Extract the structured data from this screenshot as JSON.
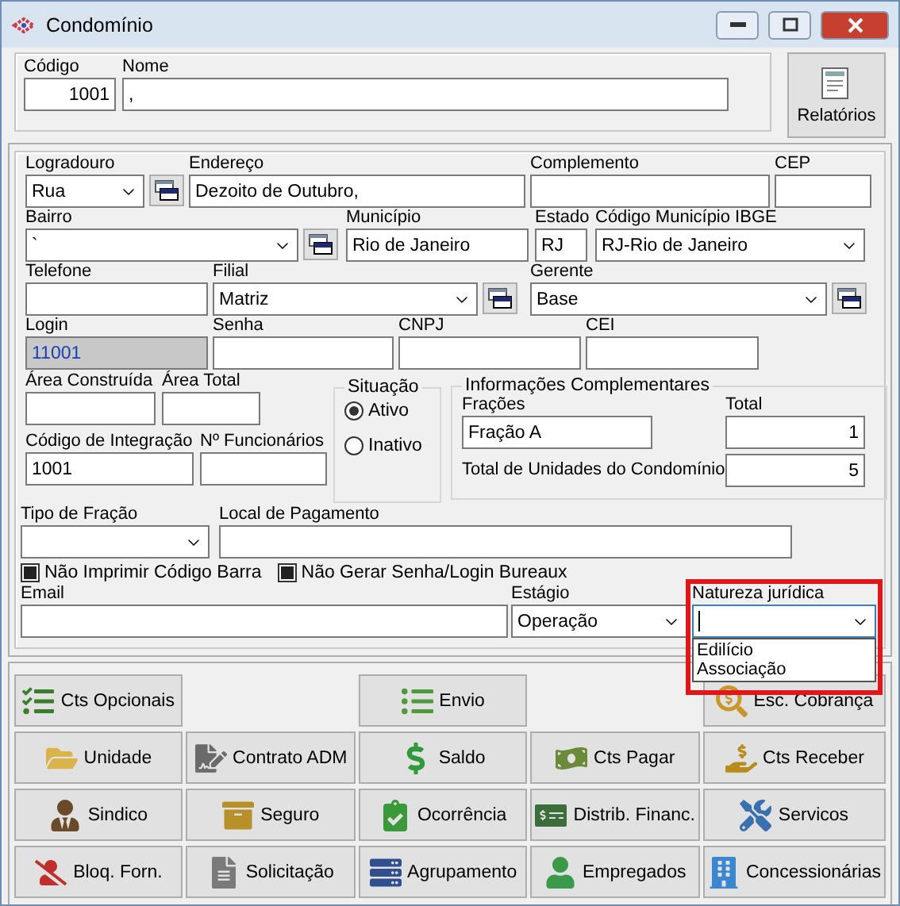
{
  "window": {
    "title": "Condomínio"
  },
  "header": {
    "fields": [
      {
        "label": "Código",
        "value": "1001"
      },
      {
        "label": "Nome",
        "value": ","
      }
    ],
    "report_button": "Relatórios"
  },
  "address_rows": [
    [
      {
        "kind": "combo",
        "label": "Logradouro",
        "value": "Rua"
      },
      {
        "kind": "lookup"
      },
      {
        "kind": "text",
        "label": "Endereço",
        "value": "Dezoito de Outubro,"
      },
      {
        "kind": "text",
        "label": "Complemento"
      },
      {
        "kind": "text",
        "label": "CEP"
      }
    ],
    [
      {
        "kind": "combo",
        "label": "Bairro",
        "value": "`"
      },
      {
        "kind": "lookup"
      },
      {
        "kind": "text",
        "label": "Município",
        "value": "Rio de Janeiro"
      },
      {
        "kind": "text",
        "label": "Estado",
        "value": "RJ"
      },
      {
        "kind": "combo",
        "label": "Código Município IBGE",
        "value": "RJ-Rio de Janeiro"
      }
    ],
    [
      {
        "kind": "text",
        "label": "Telefone"
      },
      {
        "kind": "combo",
        "label": "Filial",
        "value": "Matriz"
      },
      {
        "kind": "lookup"
      },
      {
        "kind": "combo",
        "label": "Gerente",
        "value": "Base"
      },
      {
        "kind": "lookup"
      }
    ],
    [
      {
        "kind": "text",
        "label": "Login",
        "value": "11001",
        "disabled": true
      },
      {
        "kind": "text",
        "label": "Senha"
      },
      {
        "kind": "text",
        "label": "CNPJ"
      },
      {
        "kind": "text",
        "label": "CEI"
      }
    ]
  ],
  "middle": {
    "fields": [
      {
        "label": "Área Construída"
      },
      {
        "label": "Área Total"
      },
      {
        "label": "Código de Integração",
        "value": "1001"
      },
      {
        "label": "Nº Funcionários"
      }
    ],
    "status": {
      "title": "Situação",
      "options": [
        {
          "label": "Ativo",
          "selected": true
        },
        {
          "label": "Inativo",
          "selected": false
        }
      ]
    },
    "extra": {
      "title": "Informações Complementares",
      "fractions": {
        "label": "Frações",
        "value": "Fração A"
      },
      "total": {
        "label": "Total",
        "value": "1"
      },
      "units": {
        "label": "Total de Unidades do Condomínio",
        "value": "5"
      }
    }
  },
  "payment_row": [
    {
      "kind": "combo",
      "label": "Tipo de Fração"
    },
    {
      "kind": "text",
      "label": "Local de Pagamento"
    }
  ],
  "checkboxes": [
    {
      "label": "Não Imprimir Código Barra",
      "checked": true
    },
    {
      "label": "Não Gerar Senha/Login Bureaux",
      "checked": true
    }
  ],
  "bottom_row": [
    {
      "kind": "text",
      "label": "Email"
    },
    {
      "kind": "combo",
      "label": "Estágio",
      "value": "Operação"
    },
    {
      "kind": "combo",
      "label": "Natureza jurídica",
      "focused": true,
      "highlighted": true,
      "open": true,
      "options": [
        "Edilício",
        "Associação"
      ]
    }
  ],
  "button_rows": [
    [
      {
        "label": "Cts Opcionais"
      },
      null,
      {
        "label": "Envio"
      },
      null,
      {
        "label": "Esc. Cobrança"
      }
    ],
    [
      {
        "label": "Unidade"
      },
      {
        "label": "Contrato ADM"
      },
      {
        "label": "Saldo"
      },
      {
        "label": "Cts Pagar"
      },
      {
        "label": "Cts Receber"
      }
    ],
    [
      {
        "label": "Sindico"
      },
      {
        "label": "Seguro"
      },
      {
        "label": "Ocorrência"
      },
      {
        "label": "Distrib. Financ."
      },
      {
        "label": "Servicos"
      }
    ],
    [
      {
        "label": "Bloq. Forn."
      },
      {
        "label": "Solicitação"
      },
      {
        "label": "Agrupamento"
      },
      {
        "label": "Empregados"
      },
      {
        "label": "Concessionárias"
      }
    ]
  ]
}
